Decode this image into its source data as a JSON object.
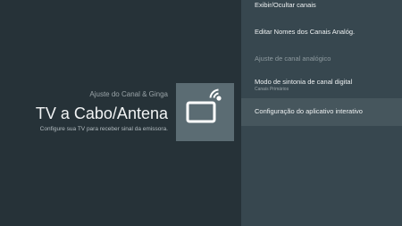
{
  "info": {
    "section_label": "Ajuste do Canal & Ginga",
    "title": "TV a Cabo/Antena",
    "subtitle": "Configure sua TV para receber sinal da emissora."
  },
  "icon": {
    "name": "tv-input-icon",
    "box_color": "#5b6c73"
  },
  "menu": {
    "items": [
      {
        "label": "Exibir/Ocultar canais",
        "sublabel": ""
      },
      {
        "label": "Editar Nomes dos Canais Analóg.",
        "sublabel": ""
      },
      {
        "label": "Ajuste de canal analógico",
        "sublabel": ""
      },
      {
        "label": "Modo de sintonia de canal digital",
        "sublabel": "Canais Primários"
      },
      {
        "label": "Configuração do aplicativo interativo",
        "sublabel": ""
      }
    ]
  },
  "colors": {
    "background": "#263238",
    "panel": "#37474f",
    "selected": "#46565d"
  }
}
